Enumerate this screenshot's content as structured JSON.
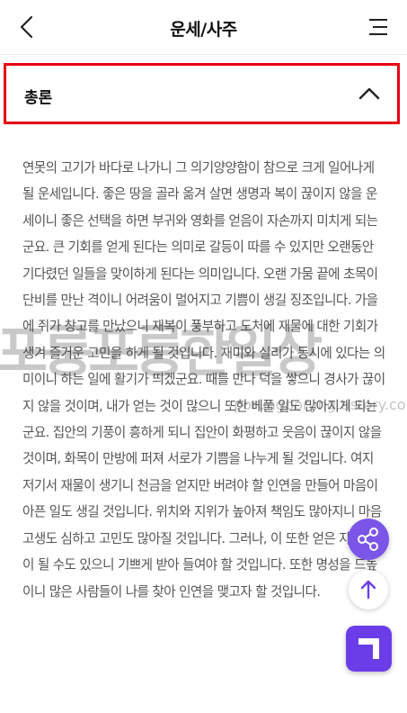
{
  "header": {
    "title": "운세/사주",
    "back_icon": "chevron-left-icon",
    "menu_icon": "hamburger-menu-icon"
  },
  "section": {
    "title": "총론",
    "toggle_icon": "chevron-up-icon",
    "highlight_color": "#e60012"
  },
  "content": {
    "paragraph": "연못의 고기가 바다로 나가니 그 의기양양함이 참으로 크게 일어나게 될 운세입니다. 좋은 땅을 골라 옮겨 살면 생명과 복이 끊이지 않을 운세이니 좋은 선택을 하면 부귀와 영화를 얻음이 자손까지 미치게 되는군요. 큰 기회를 얻게 된다는 의미로 갈등이 따를 수 있지만 오랜동안 기다렸던 일들을 맞이하게 된다는 의미입니다. 오랜 가뭄 끝에 초목이 단비를 만난 격이니 어려움이 멀어지고 기쁨이 생길 징조입니다. 가을에 쥐가 창고를 만났으니 재복이 풍부하고 도처에 재물에 대한 기회가 생겨 즐거운 고민을 하게 될 것입니다. 재미와 실리가 동시에 있다는 의미이니 하는 일에 활기가 띄겠군요. 때를 만나 덕을 쌓으니 경사가 끊이지 않을 것이며, 내가 얻는 것이 많으니 또한 베풀 일도 많아지게 되는군요. 집안의 기풍이 흥하게 되니 집안이 화평하고 웃음이 끊이지 않을 것이며, 화목이 만방에 퍼져 서로가 기쁨을 나누게 될 것입니다. 여지 저기서 재물이 생기니 천금을 얻지만 버려야 할 인연을 만들어 마음이 아픈 일도 생길 것입니다. 위치와 지위가 높아져 책임도 많아지니 마음고생도 심하고 고민도 많아질 것입니다. 그러나, 이 또한 얻은 자의 복이 될 수도 있으니 기쁘게 받아 들여야 할 것입니다. 또한 명성을 드높이니 많은 사람들이 나를 찾아 인연을 맺고자 할 것입니다."
  },
  "watermark": {
    "main": "포룽포룽한일상",
    "sub": "porungporung.tistory.com"
  },
  "floating": {
    "share_icon": "share-icon",
    "top_icon": "arrow-up-icon",
    "app_icon": "app-logo-icon",
    "accent": "#7b55e8"
  }
}
